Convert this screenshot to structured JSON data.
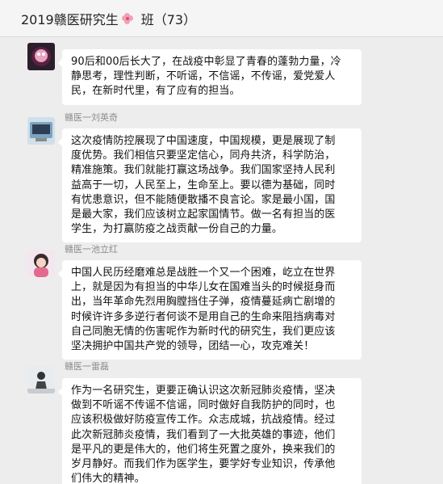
{
  "header": {
    "title_prefix": "2019赣医研究生",
    "title_suffix": "班（73）"
  },
  "messages": [
    {
      "sender": "",
      "lines": [
        "90后和00后长大了，在战疫中彰显了青春的蓬勃力量，冷",
        "静思考，理性判断，不听谣，不信谣，不传谣，爱党爱人",
        "民，在新时代里，有了应有的担当。"
      ]
    },
    {
      "sender": "赣医一刘英奇",
      "lines": [
        "这次疫情防控展现了中国速度，中国规模，更是展现了制",
        "度优势。我们相信只要坚定信心，同舟共济，科学防治，",
        "精准施策。我们就能打赢这场战争。我们国家坚持人民利",
        "益高于一切，人民至上，生命至上。要以德为基础，同时",
        "有忧患意识，但不能随便散播不良言论。家是最小国，国",
        "是最大家，我们应该树立起家国情节。做一名有担当的医",
        "学生，为打赢防疫之战贡献一份自己的力量。"
      ]
    },
    {
      "sender": "赣医一池立红",
      "lines": [
        "中国人民历经磨难总是战胜一个又一个困难，屹立在世界",
        "上，就是因为有担当的中华儿女在国难当头的时候挺身而",
        "出，当年革命先烈用胸膛挡住子弹，疫情蔓延病亡剧增的",
        "时候许许多多逆行者何谈不是用自己的生命来阻挡病毒对",
        "自己同胞无情的伤害呢作为新时代的研究生，我们更应该",
        "坚决拥护中国共产党的领导，团结一心，攻克难关！"
      ]
    },
    {
      "sender": "赣医一雷磊",
      "lines": [
        "作为一名研究生，更要正确认识这次新冠肺炎疫情，坚决",
        "做到不听谣不传谣不信谣，同时做好自我防护的同时，也",
        "应该积极做好防疫宣传工作。众志成城，抗战疫情。经过",
        "此次新冠肺炎疫情，我们看到了一大批英雄的事迹，他们",
        "是平凡的更是伟大的，他们将生死置之度外，换来我们的",
        "岁月静好。而我们作为医学生，要学好专业知识，传承他",
        "们伟大的精神。"
      ]
    }
  ]
}
